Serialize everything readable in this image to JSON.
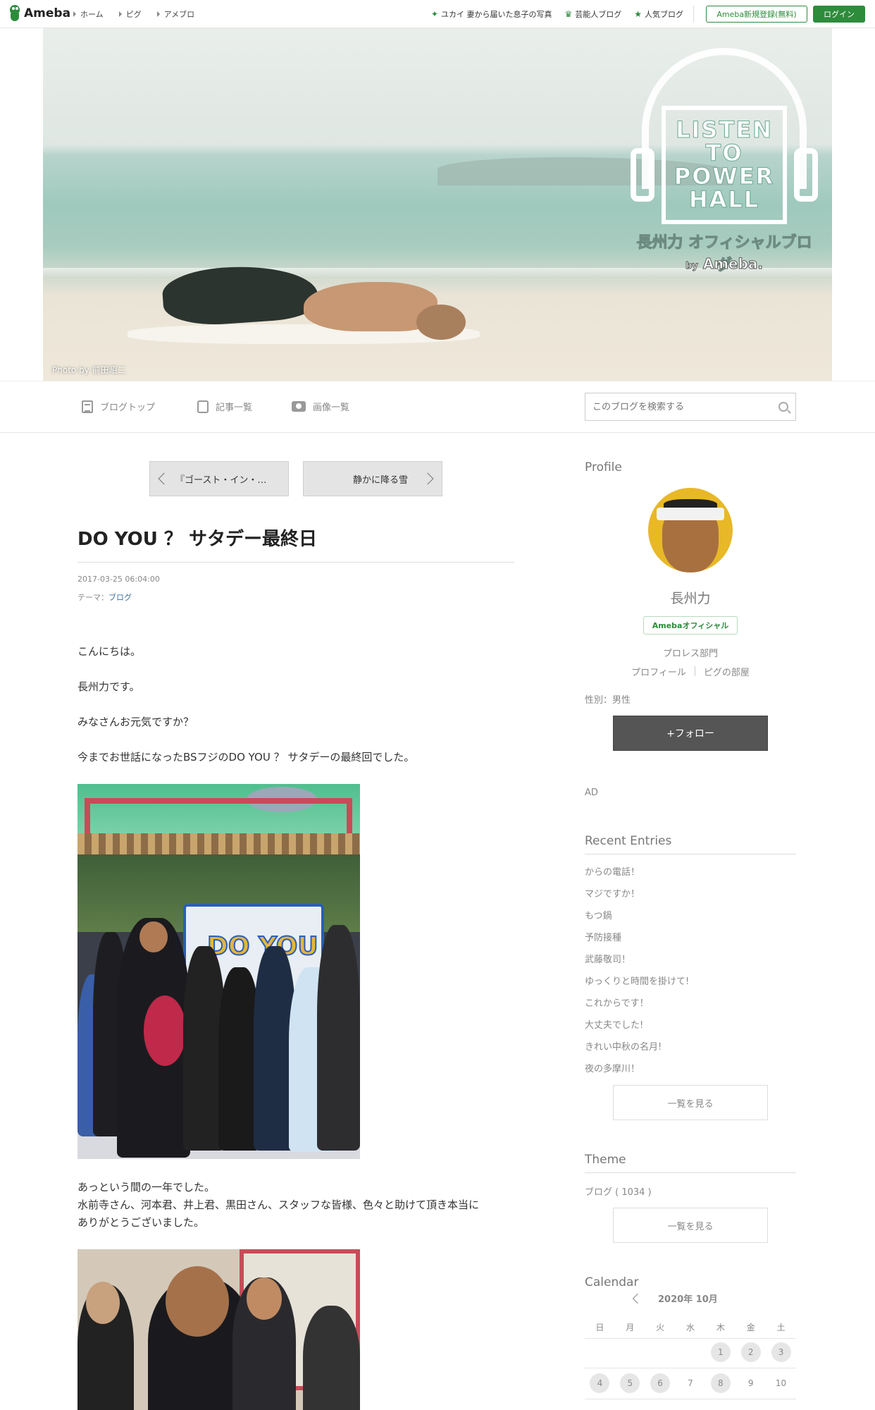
{
  "topnav": {
    "logo": "Ameba",
    "crumbs": [
      "ホーム",
      "ピグ",
      "アメブロ"
    ],
    "links": [
      {
        "icon": "sparkle-icon",
        "label": "ユカイ 妻から届いた息子の写真"
      },
      {
        "icon": "crown-icon",
        "label": "芸能人ブログ"
      },
      {
        "icon": "star-icon",
        "label": "人気ブログ"
      }
    ],
    "signup": "Ameba新規登録(無料)",
    "login": "ログイン"
  },
  "hero": {
    "logo_lines": [
      "LISTEN",
      "TO",
      "POWER",
      "HALL"
    ],
    "blog_name": "長州力 オフィシャルブログ",
    "by": "by",
    "brand": "Ameba.",
    "credit": "Photo by 前田昭二"
  },
  "blognav": {
    "items": [
      "ブログトップ",
      "記事一覧",
      "画像一覧"
    ],
    "search_placeholder": "このブログを検索する"
  },
  "article": {
    "prev": "『ゴースト・イン・…",
    "next": "静かに降る雪",
    "title": "DO YOU ？ サタデー最終日",
    "date": "2017-03-25 06:04:00",
    "theme_prefix": "テーマ：",
    "theme": "ブログ",
    "paragraphs": [
      "こんにちは。",
      "長州力です。",
      "みなさんお元気ですか？",
      "今までお世話になったBSフジのDO YOU ？ サタデーの最終回でした。"
    ],
    "photo1_sign": "DO YOU",
    "after_photo": "あっという間の一年でした。",
    "thanks_1": "水前寺さん、河本君、井上君、黒田さん、スタッフな皆様、色々と助けて頂き本当に",
    "thanks_2": "ありがとうございました。"
  },
  "sidebar": {
    "profile_heading": "Profile",
    "name": "長州力",
    "badge": "Amebaオフィシャル",
    "category": "プロレス部門",
    "links": [
      "プロフィール",
      "ピグの部屋"
    ],
    "sex": "性別：男性",
    "follow": "+フォロー",
    "ad": "AD",
    "recent_heading": "Recent Entries",
    "recent": [
      "からの電話！",
      "マジですか！",
      "もつ鍋",
      "予防接種",
      "武藤敬司！",
      "ゆっくりと時間を掛けて!",
      "これからです！",
      "大丈夫でした!",
      "きれい中秋の名月!",
      "夜の多摩川！"
    ],
    "more1": "一覧を見る",
    "theme_heading": "Theme",
    "theme_item": "ブログ ( 1034 )",
    "more2": "一覧を見る",
    "calendar_heading": "Calendar",
    "calendar_month": "2020年 10月",
    "weekdays": [
      "日",
      "月",
      "火",
      "水",
      "木",
      "金",
      "土"
    ],
    "week1": [
      "",
      "",
      "",
      "",
      "1",
      "2",
      "3"
    ],
    "week2": [
      "4",
      "5",
      "6",
      "7",
      "8",
      "9",
      "10"
    ]
  }
}
